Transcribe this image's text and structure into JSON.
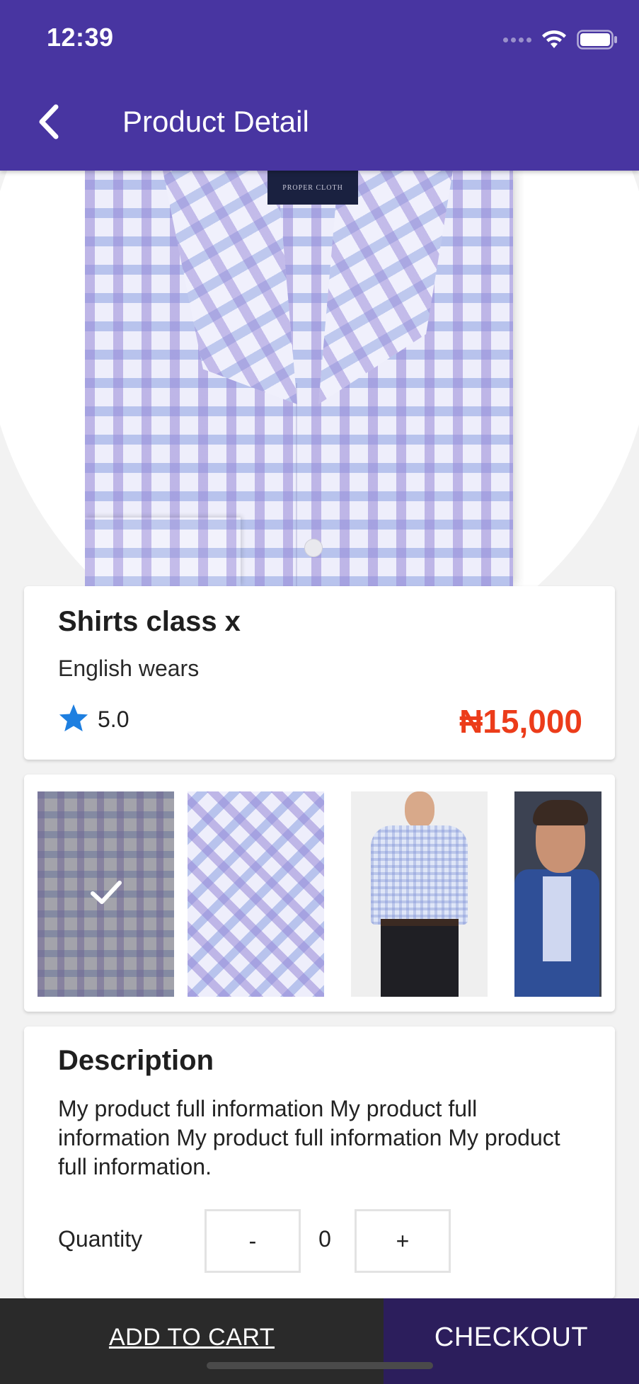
{
  "status_bar": {
    "time": "12:39",
    "icons": [
      "signal-icon",
      "wifi-icon",
      "battery-icon"
    ]
  },
  "header": {
    "back_icon": "chevron-left-icon",
    "title": "Product Detail"
  },
  "hero": {
    "brand_label": "PROPER CLOTH"
  },
  "product": {
    "name": "Shirts class x",
    "category": "English wears",
    "rating_icon": "star-icon",
    "rating": "5.0",
    "price": "₦15,000"
  },
  "gallery": {
    "selected_index": 0,
    "selected_icon": "checkmark-icon",
    "thumbnails": [
      "folded-plaid-shirt",
      "plaid-collar-closeup",
      "model-wearing-shirt",
      "model-in-blue-jacket"
    ]
  },
  "description": {
    "title": "Description",
    "text": "My product full information My product full information My product full information My product full information.",
    "quantity_label": "Quantity",
    "minus_label": "-",
    "quantity_value": "0",
    "plus_label": "+"
  },
  "actions": {
    "add_to_cart": "ADD TO CART",
    "checkout": "CHECKOUT"
  },
  "colors": {
    "primary": "#4835a1",
    "price": "#ec3c1a",
    "star": "#1e7fe0",
    "add_to_cart_bg": "#2a2a2a",
    "checkout_bg": "#2c1e5c"
  }
}
